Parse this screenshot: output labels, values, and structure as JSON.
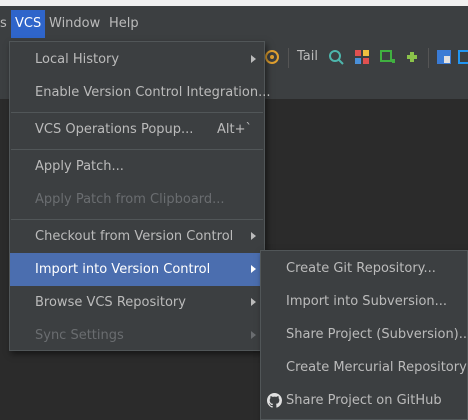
{
  "menubar": {
    "items": [
      {
        "label": "s"
      },
      {
        "label": "VCS"
      },
      {
        "label": "Window"
      },
      {
        "label": "Help"
      }
    ]
  },
  "toolbar": {
    "tail_label": "Tail"
  },
  "vcs_menu": {
    "items": [
      {
        "label": "Local History",
        "submenu": true,
        "enabled": true
      },
      {
        "label": "Enable Version Control Integration...",
        "enabled": true
      },
      {
        "label": "VCS Operations Popup...",
        "shortcut": "Alt+`",
        "enabled": true
      },
      {
        "label": "Apply Patch...",
        "enabled": true
      },
      {
        "label": "Apply Patch from Clipboard...",
        "enabled": false
      },
      {
        "label": "Checkout from Version Control",
        "submenu": true,
        "enabled": true
      },
      {
        "label": "Import into Version Control",
        "submenu": true,
        "enabled": true,
        "selected": true
      },
      {
        "label": "Browse VCS Repository",
        "submenu": true,
        "enabled": true
      },
      {
        "label": "Sync Settings",
        "submenu": true,
        "enabled": false
      }
    ]
  },
  "import_submenu": {
    "items": [
      {
        "label": "Create Git Repository..."
      },
      {
        "label": "Import into Subversion..."
      },
      {
        "label": "Share Project (Subversion)..."
      },
      {
        "label": "Create Mercurial Repository"
      },
      {
        "label": "Share Project on GitHub",
        "icon": "github-icon"
      }
    ]
  },
  "colors": {
    "menu_bg": "#3c3f41",
    "selection": "#4b6eaf",
    "menubar_active": "#2f65ca",
    "text": "#bbbbbb",
    "disabled_text": "#6a6d70"
  }
}
